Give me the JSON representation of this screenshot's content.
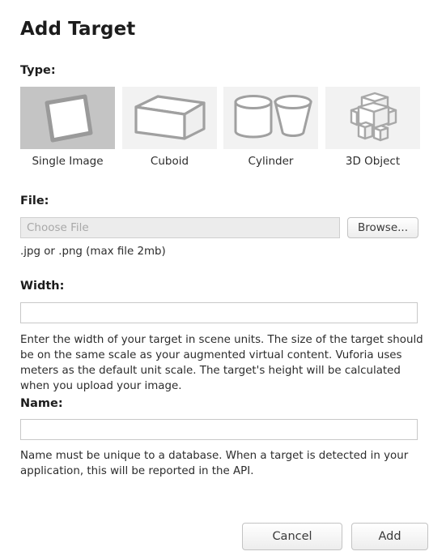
{
  "dialog": {
    "title": "Add Target"
  },
  "type_section": {
    "label": "Type:",
    "selected_index": 0,
    "selected_bg": "#c4c4c4",
    "unselected_bg": "#f2f2f2",
    "options": [
      {
        "label": "Single Image",
        "icon": "single-image-icon",
        "selected": true
      },
      {
        "label": "Cuboid",
        "icon": "cuboid-icon",
        "selected": false
      },
      {
        "label": "Cylinder",
        "icon": "cylinder-icon",
        "selected": false
      },
      {
        "label": "3D Object",
        "icon": "three-d-object-icon",
        "selected": false
      }
    ]
  },
  "file_section": {
    "label": "File:",
    "input_value": "",
    "input_placeholder": "Choose File",
    "browse_label": "Browse...",
    "help": ".jpg or .png (max file 2mb)"
  },
  "width_section": {
    "label": "Width:",
    "input_value": "",
    "input_placeholder": "",
    "help": "Enter the width of your target in scene units. The size of the target should be on the same scale as your augmented virtual content. Vuforia uses meters as the default unit scale. The target's height will be calculated when you upload your image."
  },
  "name_section": {
    "label": "Name:",
    "input_value": "",
    "input_placeholder": "",
    "help": "Name must be unique to a database. When a target is detected in your application, this will be reported in the API."
  },
  "footer": {
    "cancel_label": "Cancel",
    "add_label": "Add"
  }
}
